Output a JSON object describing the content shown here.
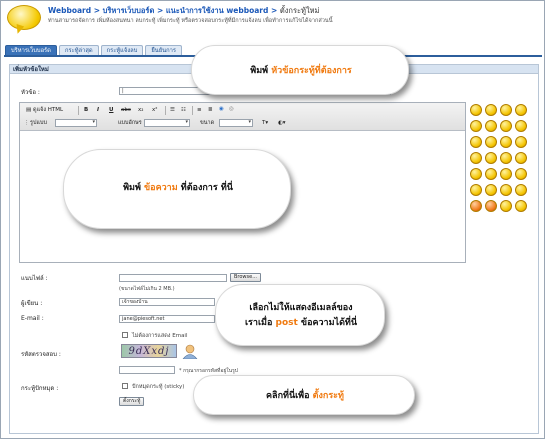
{
  "header": {
    "breadcrumb": {
      "home": "Webboard",
      "sep1": " > ",
      "item1": "บริหารเว็บบอร์ด",
      "sep2": " > ",
      "item2": "แนะนำการใช้งาน webboard",
      "sep3": " > ",
      "current": "ตั้งกระทู้ใหม่"
    },
    "description": "ท่านสามารถจัดการ เพิ่มห้องสนทนา ลบกระทู้ เพิ่มกระทู้ หรือตรวจสอบกระทู้ที่มีการแจ้งลบ เพื่อทำการแก้ไขได้จากส่วนนี้"
  },
  "tabs": [
    {
      "label": "บริหารเว็บบอร์ด",
      "active": true
    },
    {
      "label": "กระทู้ล่าสุด",
      "active": false
    },
    {
      "label": "กระทู้แจ้งลบ",
      "active": false
    },
    {
      "label": "ยืนยันการ",
      "active": false
    }
  ],
  "form": {
    "heading": "เพิ่มหัวข้อใหม่",
    "title_label": "หัวข้อ :",
    "title_value": "|",
    "editor": {
      "source_button": "ดูแจ้ง HTML",
      "bold": "B",
      "italic": "I",
      "underline": "U",
      "strike": "abc",
      "subscript": "x₂",
      "superscript": "x²",
      "format_label": "รูปแบบ",
      "font_label": "แบบอักษร",
      "size_label": "ขนาด"
    },
    "attachment_label": "แนบไฟล์ :",
    "browse_button": "Browse...",
    "attachment_hint": "(ขนาดไฟล์ไม่เกิน 2 MB.)",
    "author_label": "ผู้เขียน :",
    "author_value": "เจ้าของบ้าน",
    "email_label": "E-mail :",
    "email_value": "jane@piesoft.net",
    "hide_email_label": "ไม่ต้องการแสดง Email",
    "captcha_label": "รหัสตรวจสอบ :",
    "captcha_text": "9dXxdj",
    "captcha_hint": "* กรุณากรอกรหัสที่อยู่ในรูป",
    "pin_label": "กระทู้ปักหมุด :",
    "pin_option": "ปักหมุดกระทู้ (sticky)",
    "submit_button": "ตั้งกระทู้"
  },
  "callouts": {
    "title": {
      "prefix": "พิมพ์ ",
      "highlight": "หัวข้อกระทู้ที่ต้องการ",
      "suffix": ""
    },
    "content": {
      "prefix": "พิมพ์ ",
      "highlight": "ข้อความ",
      "suffix": " ที่ต้องการ ที่นี่"
    },
    "email_line1": "เลือกไม่ให้แสดงอีเมลล์ของ",
    "email_line2": {
      "prefix": "เราเมื่อ ",
      "highlight": "post",
      "suffix": " ข้อความได้ที่นี่"
    },
    "submit": {
      "prefix": "คลิกที่นี่เพื่อ ",
      "highlight": "ตั้งกระทู้",
      "suffix": ""
    }
  },
  "colors": {
    "accent": "#f07a10",
    "tab_active": "#3a72b8",
    "link": "#1b58b8"
  }
}
